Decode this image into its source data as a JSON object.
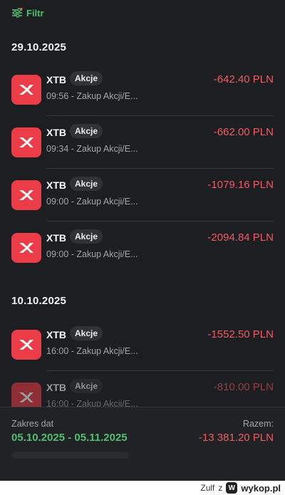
{
  "filter": {
    "label": "Filtr"
  },
  "groups": [
    {
      "date": "29.10.2025",
      "transactions": [
        {
          "name": "XTB",
          "badge": "Akcje",
          "desc": "09:56 - Zakup Akcji/E...",
          "amount": "-642.40 PLN"
        },
        {
          "name": "XTB",
          "badge": "Akcje",
          "desc": "09:34 - Zakup Akcji/E...",
          "amount": "-662.00 PLN"
        },
        {
          "name": "XTB",
          "badge": "Akcje",
          "desc": "09:00 - Zakup Akcji/E...",
          "amount": "-1079.16 PLN"
        },
        {
          "name": "XTB",
          "badge": "Akcje",
          "desc": "09:00 - Zakup Akcji/E...",
          "amount": "-2094.84 PLN"
        }
      ]
    },
    {
      "date": "10.10.2025",
      "transactions": [
        {
          "name": "XTB",
          "badge": "Akcje",
          "desc": "16:00 - Zakup Akcji/E...",
          "amount": "-1552.50 PLN"
        },
        {
          "name": "XTB",
          "badge": "Akcje",
          "desc": "16:00 - Zakup Akcji/E...",
          "amount": "-810.00 PLN"
        }
      ]
    }
  ],
  "summary": {
    "range_label": "Zakres dat",
    "range_value": "05.10.2025 - 05.11.2025",
    "total_label": "Razem:",
    "total_value": "-13 381.20 PLN"
  },
  "footer": {
    "credit": "Zulf",
    "credit_sep": "z",
    "site": "wykop.pl",
    "site_icon": "W"
  },
  "colors": {
    "background": "#1d1e21",
    "accent_green": "#4fbf6f",
    "amount_red": "#f05a62",
    "logo_red": "#ec3c47"
  },
  "icons": {
    "filter": "sliders-icon",
    "logo": "xtb-x-logo"
  }
}
